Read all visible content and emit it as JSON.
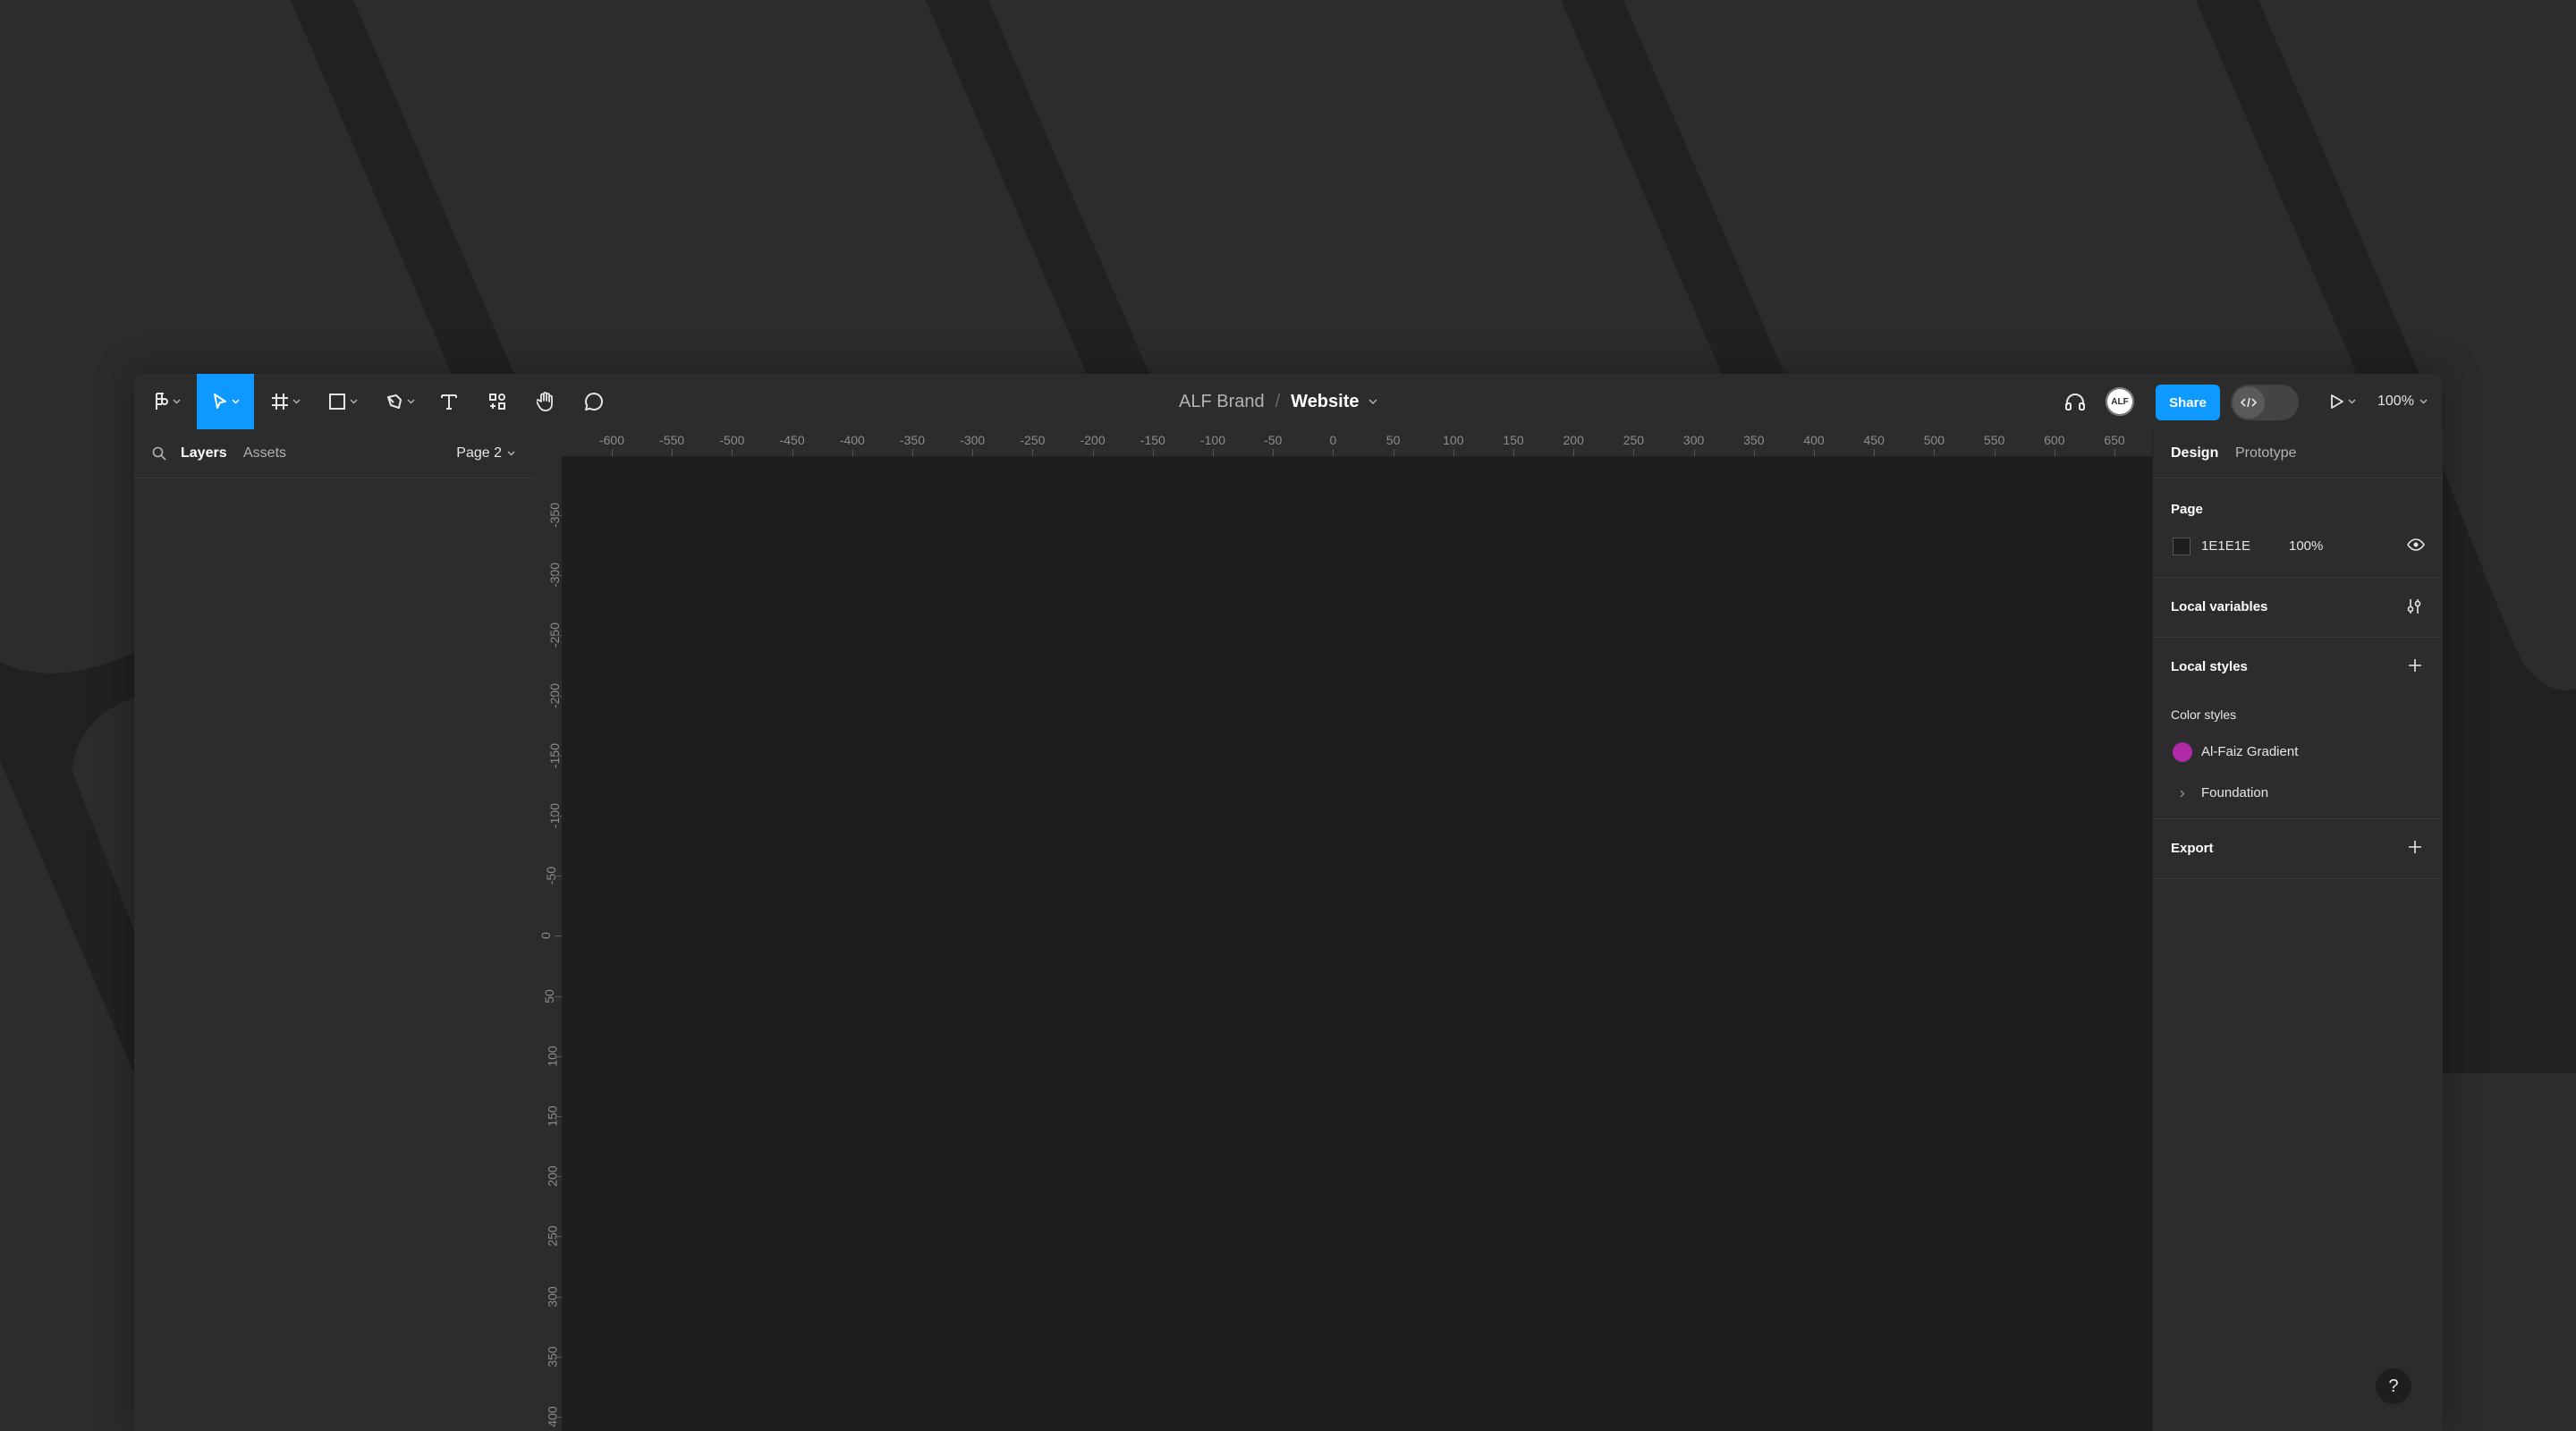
{
  "toolbar": {
    "breadcrumb": "ALF Brand",
    "separator": "/",
    "file_name": "Website",
    "share_label": "Share",
    "avatar_initials": "ALF",
    "zoom_label": "100%"
  },
  "left_panel": {
    "tabs": [
      "Layers",
      "Assets"
    ],
    "page_selector": "Page 2"
  },
  "rulers": {
    "top": [
      "-600",
      "-550",
      "-500",
      "-450",
      "-400",
      "-350",
      "-300",
      "-250",
      "-200",
      "-150",
      "-100",
      "-50",
      "0",
      "50",
      "100",
      "150",
      "200",
      "250",
      "300",
      "350",
      "400",
      "450",
      "500",
      "550",
      "600",
      "650"
    ],
    "left": [
      "-350",
      "-300",
      "-250",
      "-200",
      "-150",
      "-100",
      "-50",
      "0",
      "50",
      "100",
      "150",
      "200",
      "250",
      "300",
      "350",
      "400"
    ]
  },
  "right_panel": {
    "tabs": [
      "Design",
      "Prototype"
    ],
    "page": {
      "heading": "Page",
      "color_hex": "1E1E1E",
      "opacity": "100%"
    },
    "local_variables": "Local variables",
    "local_styles": "Local styles",
    "color_styles_label": "Color styles",
    "color_styles": [
      {
        "name": "Al-Faiz Gradient",
        "swatch": "#b02aa6"
      },
      {
        "name": "Foundation"
      }
    ],
    "export": "Export"
  },
  "help_label": "?",
  "colors": {
    "accent": "#0d99ff",
    "canvas": "#1e1e1e",
    "chrome": "#2c2c2c"
  }
}
